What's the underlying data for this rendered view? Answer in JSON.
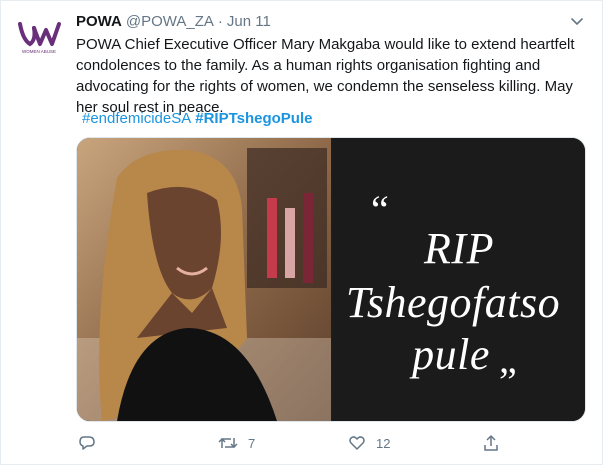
{
  "tweet": {
    "display_name": "POWA",
    "handle": "@POWA_ZA",
    "separator": "·",
    "date": "Jun 11",
    "text": "POWA Chief Executive Officer Mary Makgaba would like to extend heartfelt condolences to the family. As a human rights organisation fighting and advocating for the rights of women, we condemn the senseless killing. May her soul rest in  peace.",
    "hashtags": [
      "#endfemicideSA",
      "#RIPTshegoPule"
    ],
    "avatar_text": "WOMEN ABUSE"
  },
  "media": {
    "card_quote_open": "“",
    "card_lines": [
      "RIP",
      "Tshegofatso",
      "pule"
    ],
    "card_quote_close": "”"
  },
  "actions": {
    "reply_count": "",
    "retweet_count": "7",
    "like_count": "12"
  },
  "colors": {
    "link": "#1b95e0",
    "muted": "#657786",
    "brand": "#6a2f7a"
  },
  "icons": [
    "chevron-down-icon",
    "reply-icon",
    "retweet-icon",
    "like-icon",
    "share-icon"
  ]
}
